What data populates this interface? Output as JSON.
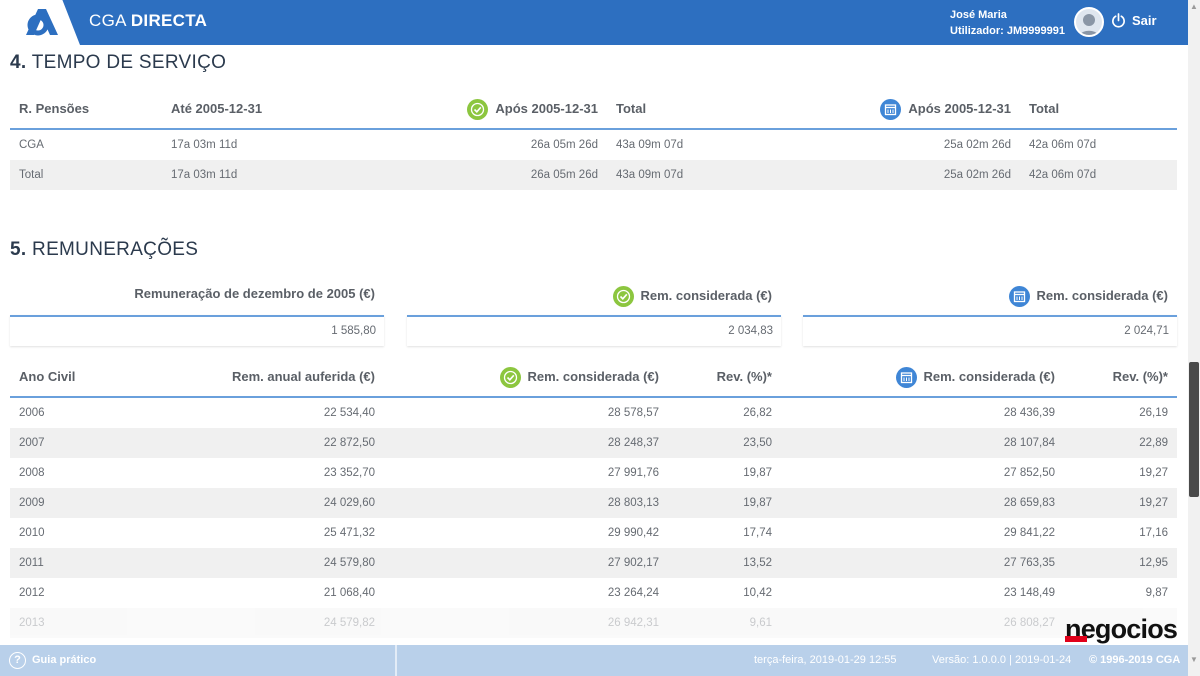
{
  "header": {
    "brand_light": "CGA",
    "brand_bold": "DIRECTA",
    "user_name": "José Maria",
    "user_id": "Utilizador: JM9999991",
    "logout_label": "Sair",
    "accent_color": "#2d6fc0"
  },
  "section4": {
    "number": "4.",
    "title": "TEMPO DE SERVIÇO",
    "columns": [
      "R. Pensões",
      "Até 2005-12-31",
      "Após 2005-12-31",
      "Total",
      "Após 2005-12-31",
      "Total"
    ],
    "rows": [
      [
        "CGA",
        "17a 03m 11d",
        "26a 05m 26d",
        "43a 09m 07d",
        "25a 02m 26d",
        "42a 06m 07d"
      ],
      [
        "Total",
        "17a 03m 11d",
        "26a 05m 26d",
        "43a 09m 07d",
        "25a 02m 26d",
        "42a 06m 07d"
      ]
    ]
  },
  "section5": {
    "number": "5.",
    "title": "REMUNERAÇÕES",
    "summary": [
      {
        "label": "Remuneração de dezembro de 2005 (€)",
        "value": "1 585,80"
      },
      {
        "label": "Rem. considerada (€)",
        "value": "2 034,83"
      },
      {
        "label": "Rem. considerada (€)",
        "value": "2 024,71"
      }
    ],
    "columns": [
      "Ano Civil",
      "Rem. anual auferida (€)",
      "Rem. considerada (€)",
      "Rev. (%)*",
      "Rem. considerada (€)",
      "Rev. (%)*"
    ],
    "rows": [
      [
        "2006",
        "22 534,40",
        "28 578,57",
        "26,82",
        "28 436,39",
        "26,19"
      ],
      [
        "2007",
        "22 872,50",
        "28 248,37",
        "23,50",
        "28 107,84",
        "22,89"
      ],
      [
        "2008",
        "23 352,70",
        "27 991,76",
        "19,87",
        "27 852,50",
        "19,27"
      ],
      [
        "2009",
        "24 029,60",
        "28 803,13",
        "19,87",
        "28 659,83",
        "19,27"
      ],
      [
        "2010",
        "25 471,32",
        "29 990,42",
        "17,74",
        "29 841,22",
        "17,16"
      ],
      [
        "2011",
        "24 579,80",
        "27 902,17",
        "13,52",
        "27 763,35",
        "12,95"
      ],
      [
        "2012",
        "21 068,40",
        "23 264,24",
        "10,42",
        "23 148,49",
        "9,87"
      ],
      [
        "2013",
        "24 579,82",
        "26 942,31",
        "9,61",
        "26 808,27",
        ""
      ]
    ]
  },
  "footer": {
    "help_label": "Guia prático",
    "datetime": "terça-feira, 2019-01-29 12:55",
    "version": "Versão: 1.0.0.0 | 2019-01-24",
    "copyright": "© 1996-2019 CGA"
  },
  "watermark": "negocios",
  "icons": {
    "check": "check-circle-icon",
    "calendar": "calendar-icon"
  }
}
